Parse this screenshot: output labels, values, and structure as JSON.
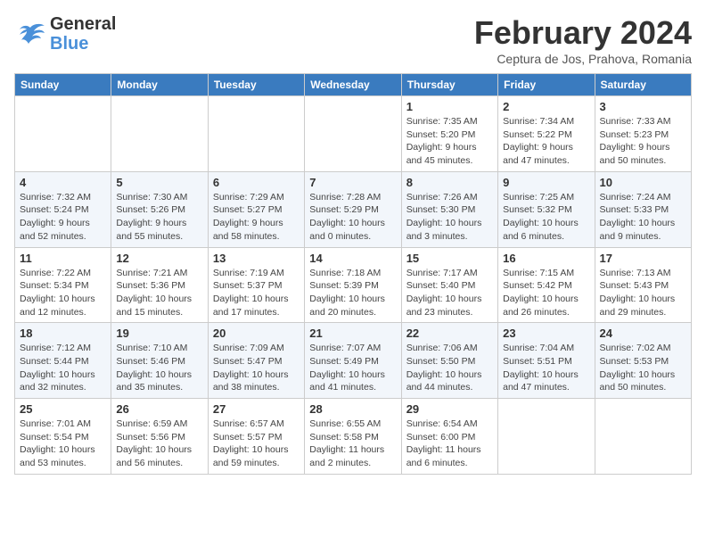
{
  "header": {
    "logo_line1": "General",
    "logo_line2": "Blue",
    "month": "February 2024",
    "location": "Ceptura de Jos, Prahova, Romania"
  },
  "weekdays": [
    "Sunday",
    "Monday",
    "Tuesday",
    "Wednesday",
    "Thursday",
    "Friday",
    "Saturday"
  ],
  "weeks": [
    [
      {
        "day": "",
        "info": ""
      },
      {
        "day": "",
        "info": ""
      },
      {
        "day": "",
        "info": ""
      },
      {
        "day": "",
        "info": ""
      },
      {
        "day": "1",
        "info": "Sunrise: 7:35 AM\nSunset: 5:20 PM\nDaylight: 9 hours\nand 45 minutes."
      },
      {
        "day": "2",
        "info": "Sunrise: 7:34 AM\nSunset: 5:22 PM\nDaylight: 9 hours\nand 47 minutes."
      },
      {
        "day": "3",
        "info": "Sunrise: 7:33 AM\nSunset: 5:23 PM\nDaylight: 9 hours\nand 50 minutes."
      }
    ],
    [
      {
        "day": "4",
        "info": "Sunrise: 7:32 AM\nSunset: 5:24 PM\nDaylight: 9 hours\nand 52 minutes."
      },
      {
        "day": "5",
        "info": "Sunrise: 7:30 AM\nSunset: 5:26 PM\nDaylight: 9 hours\nand 55 minutes."
      },
      {
        "day": "6",
        "info": "Sunrise: 7:29 AM\nSunset: 5:27 PM\nDaylight: 9 hours\nand 58 minutes."
      },
      {
        "day": "7",
        "info": "Sunrise: 7:28 AM\nSunset: 5:29 PM\nDaylight: 10 hours\nand 0 minutes."
      },
      {
        "day": "8",
        "info": "Sunrise: 7:26 AM\nSunset: 5:30 PM\nDaylight: 10 hours\nand 3 minutes."
      },
      {
        "day": "9",
        "info": "Sunrise: 7:25 AM\nSunset: 5:32 PM\nDaylight: 10 hours\nand 6 minutes."
      },
      {
        "day": "10",
        "info": "Sunrise: 7:24 AM\nSunset: 5:33 PM\nDaylight: 10 hours\nand 9 minutes."
      }
    ],
    [
      {
        "day": "11",
        "info": "Sunrise: 7:22 AM\nSunset: 5:34 PM\nDaylight: 10 hours\nand 12 minutes."
      },
      {
        "day": "12",
        "info": "Sunrise: 7:21 AM\nSunset: 5:36 PM\nDaylight: 10 hours\nand 15 minutes."
      },
      {
        "day": "13",
        "info": "Sunrise: 7:19 AM\nSunset: 5:37 PM\nDaylight: 10 hours\nand 17 minutes."
      },
      {
        "day": "14",
        "info": "Sunrise: 7:18 AM\nSunset: 5:39 PM\nDaylight: 10 hours\nand 20 minutes."
      },
      {
        "day": "15",
        "info": "Sunrise: 7:17 AM\nSunset: 5:40 PM\nDaylight: 10 hours\nand 23 minutes."
      },
      {
        "day": "16",
        "info": "Sunrise: 7:15 AM\nSunset: 5:42 PM\nDaylight: 10 hours\nand 26 minutes."
      },
      {
        "day": "17",
        "info": "Sunrise: 7:13 AM\nSunset: 5:43 PM\nDaylight: 10 hours\nand 29 minutes."
      }
    ],
    [
      {
        "day": "18",
        "info": "Sunrise: 7:12 AM\nSunset: 5:44 PM\nDaylight: 10 hours\nand 32 minutes."
      },
      {
        "day": "19",
        "info": "Sunrise: 7:10 AM\nSunset: 5:46 PM\nDaylight: 10 hours\nand 35 minutes."
      },
      {
        "day": "20",
        "info": "Sunrise: 7:09 AM\nSunset: 5:47 PM\nDaylight: 10 hours\nand 38 minutes."
      },
      {
        "day": "21",
        "info": "Sunrise: 7:07 AM\nSunset: 5:49 PM\nDaylight: 10 hours\nand 41 minutes."
      },
      {
        "day": "22",
        "info": "Sunrise: 7:06 AM\nSunset: 5:50 PM\nDaylight: 10 hours\nand 44 minutes."
      },
      {
        "day": "23",
        "info": "Sunrise: 7:04 AM\nSunset: 5:51 PM\nDaylight: 10 hours\nand 47 minutes."
      },
      {
        "day": "24",
        "info": "Sunrise: 7:02 AM\nSunset: 5:53 PM\nDaylight: 10 hours\nand 50 minutes."
      }
    ],
    [
      {
        "day": "25",
        "info": "Sunrise: 7:01 AM\nSunset: 5:54 PM\nDaylight: 10 hours\nand 53 minutes."
      },
      {
        "day": "26",
        "info": "Sunrise: 6:59 AM\nSunset: 5:56 PM\nDaylight: 10 hours\nand 56 minutes."
      },
      {
        "day": "27",
        "info": "Sunrise: 6:57 AM\nSunset: 5:57 PM\nDaylight: 10 hours\nand 59 minutes."
      },
      {
        "day": "28",
        "info": "Sunrise: 6:55 AM\nSunset: 5:58 PM\nDaylight: 11 hours\nand 2 minutes."
      },
      {
        "day": "29",
        "info": "Sunrise: 6:54 AM\nSunset: 6:00 PM\nDaylight: 11 hours\nand 6 minutes."
      },
      {
        "day": "",
        "info": ""
      },
      {
        "day": "",
        "info": ""
      }
    ]
  ]
}
